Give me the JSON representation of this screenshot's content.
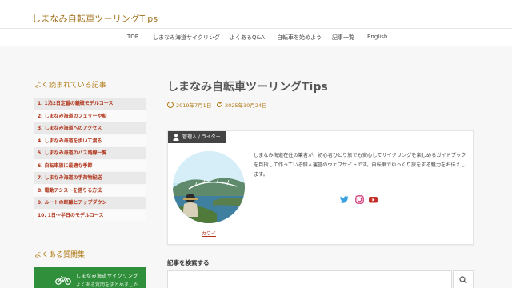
{
  "header": {
    "site_title": "しまなみ自転車ツーリングTips"
  },
  "nav": {
    "items": [
      "TOP",
      "しまなみ海道サイクリング",
      "よくあるQ&A",
      "自転車を始めよう",
      "記事一覧",
      "English"
    ]
  },
  "sidebar": {
    "popular_heading": "よく読まれている記事",
    "popular_items": [
      "1. 1泊2日定番の鏡破モデルコース",
      "2. しまなみ海道のフェリーや船",
      "3. しまなみ海道へのアクセス",
      "4. しまなみ海道を歩いて渡る",
      "5. しまなみ海道のバス路線一覧",
      "6. 自転車旅に最適な季節",
      "7. しまなみ海道の手荷物配送",
      "8. 電動アシストを借りる方法",
      "9. ルートの距離とアップダウン",
      "10. 1日～半日のモデルコース"
    ],
    "faq_heading": "よくある質問集",
    "faq_banner": {
      "line1": "しまなみ海道サイクリング",
      "line2": "よくある質問をまとめました"
    }
  },
  "article": {
    "title": "しまなみ自転車ツーリングTips",
    "published": "2019年7月1日",
    "updated": "2025年10月24日"
  },
  "author": {
    "label": "管理人 / ライター",
    "name": "カワイ",
    "description": "しまなみ海道在住の筆者が、初心者ひとり旅でも安心してサイクリングを楽しめるガイドブックを目指して作っている個人運営のウェブサイトです。自転車でゆっくり旅をする魅力をお伝えします。",
    "social": [
      "twitter-icon",
      "instagram-icon",
      "youtube-icon"
    ]
  },
  "search": {
    "heading": "記事を検索する",
    "placeholder": ""
  },
  "colors": {
    "accent": "#b07a14",
    "link": "#b0341a",
    "banner": "#2f8f3a"
  }
}
